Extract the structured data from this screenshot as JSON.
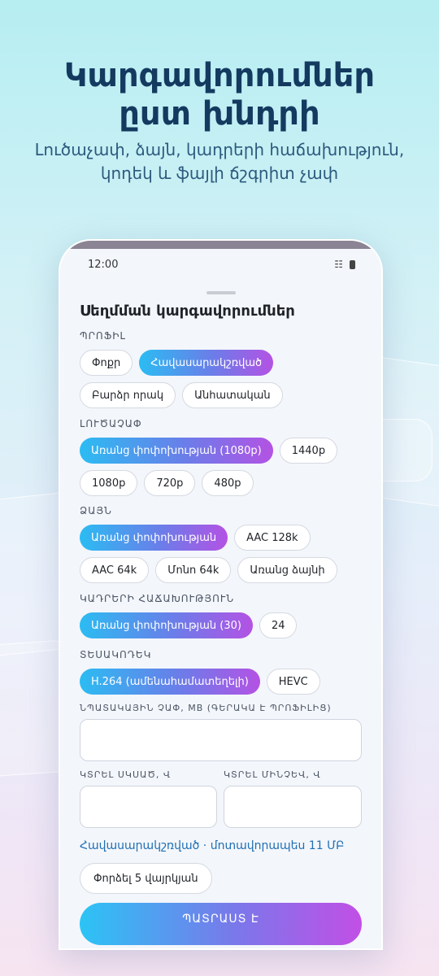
{
  "hero": {
    "title_line1": "Կարգավորումներ",
    "title_line2": "ըստ խնդրի",
    "subtitle_line1": "Լուծաչափ, ձայն, կադրերի հաճախություն,",
    "subtitle_line2": "կոդեկ և ֆայլի ճշգրիտ չափ"
  },
  "status_bar": {
    "time": "12:00",
    "signal_icon": "signal-icon",
    "battery_icon": "battery-icon"
  },
  "sheet": {
    "title": "Սեղմման կարգավորումներ",
    "profile": {
      "label": "ՊՐՈՖԻԼ",
      "options": [
        "Փոքր",
        "Հավասարակշռված",
        "Բարձր որակ",
        "Անհատական"
      ],
      "selected": "Հավասարակշռված"
    },
    "resolution": {
      "label": "ԼՈՒԾԱՉԱՓ",
      "options": [
        "Առանց փոփոխության (1080p)",
        "1440p",
        "1080p",
        "720p",
        "480p"
      ],
      "selected": "Առանց փոփոխության (1080p)"
    },
    "audio": {
      "label": "ՁԱՅՆ",
      "options": [
        "Առանց փոփոխության",
        "AAC 128k",
        "AAC 64k",
        "Մոնո 64k",
        "Առանց ձայնի"
      ],
      "selected": "Առանց փոփոխության"
    },
    "framerate": {
      "label": "ԿԱԴՐԵՐԻ ՀԱՃԱԽՈՒԹՅՈՒՆ",
      "options": [
        "Առանց փոփոխության (30)",
        "24"
      ],
      "selected": "Առանց փոփոխության (30)"
    },
    "codec": {
      "label": "ՏԵՍԱԿՈԴԵԿ",
      "options": [
        "H.264 (ամենահամատեղելի)",
        "HEVC"
      ],
      "selected": "H.264 (ամենահամատեղելի)"
    },
    "target_size": {
      "label": "ՆՊԱՏԱԿԱՅԻՆ ՉԱՓ, MB (ԳԵՐԱԿԱ Է ՊՐՈՖԻԼԻՑ)",
      "value": ""
    },
    "trim_start": {
      "label": "ԿՏՐԵԼ ՍԿՍԱԾ, Վ",
      "value": ""
    },
    "trim_end": {
      "label": "ԿՏՐԵԼ ՄԻՆՉԵՎ, Վ",
      "value": ""
    },
    "summary": "Հավասարակշռված · մոտավորապես 11 ՄԲ",
    "reset_label": "Փորձել 5 վայրկյան",
    "done_label": "ՊԱՏՐԱՍՏ Է"
  }
}
